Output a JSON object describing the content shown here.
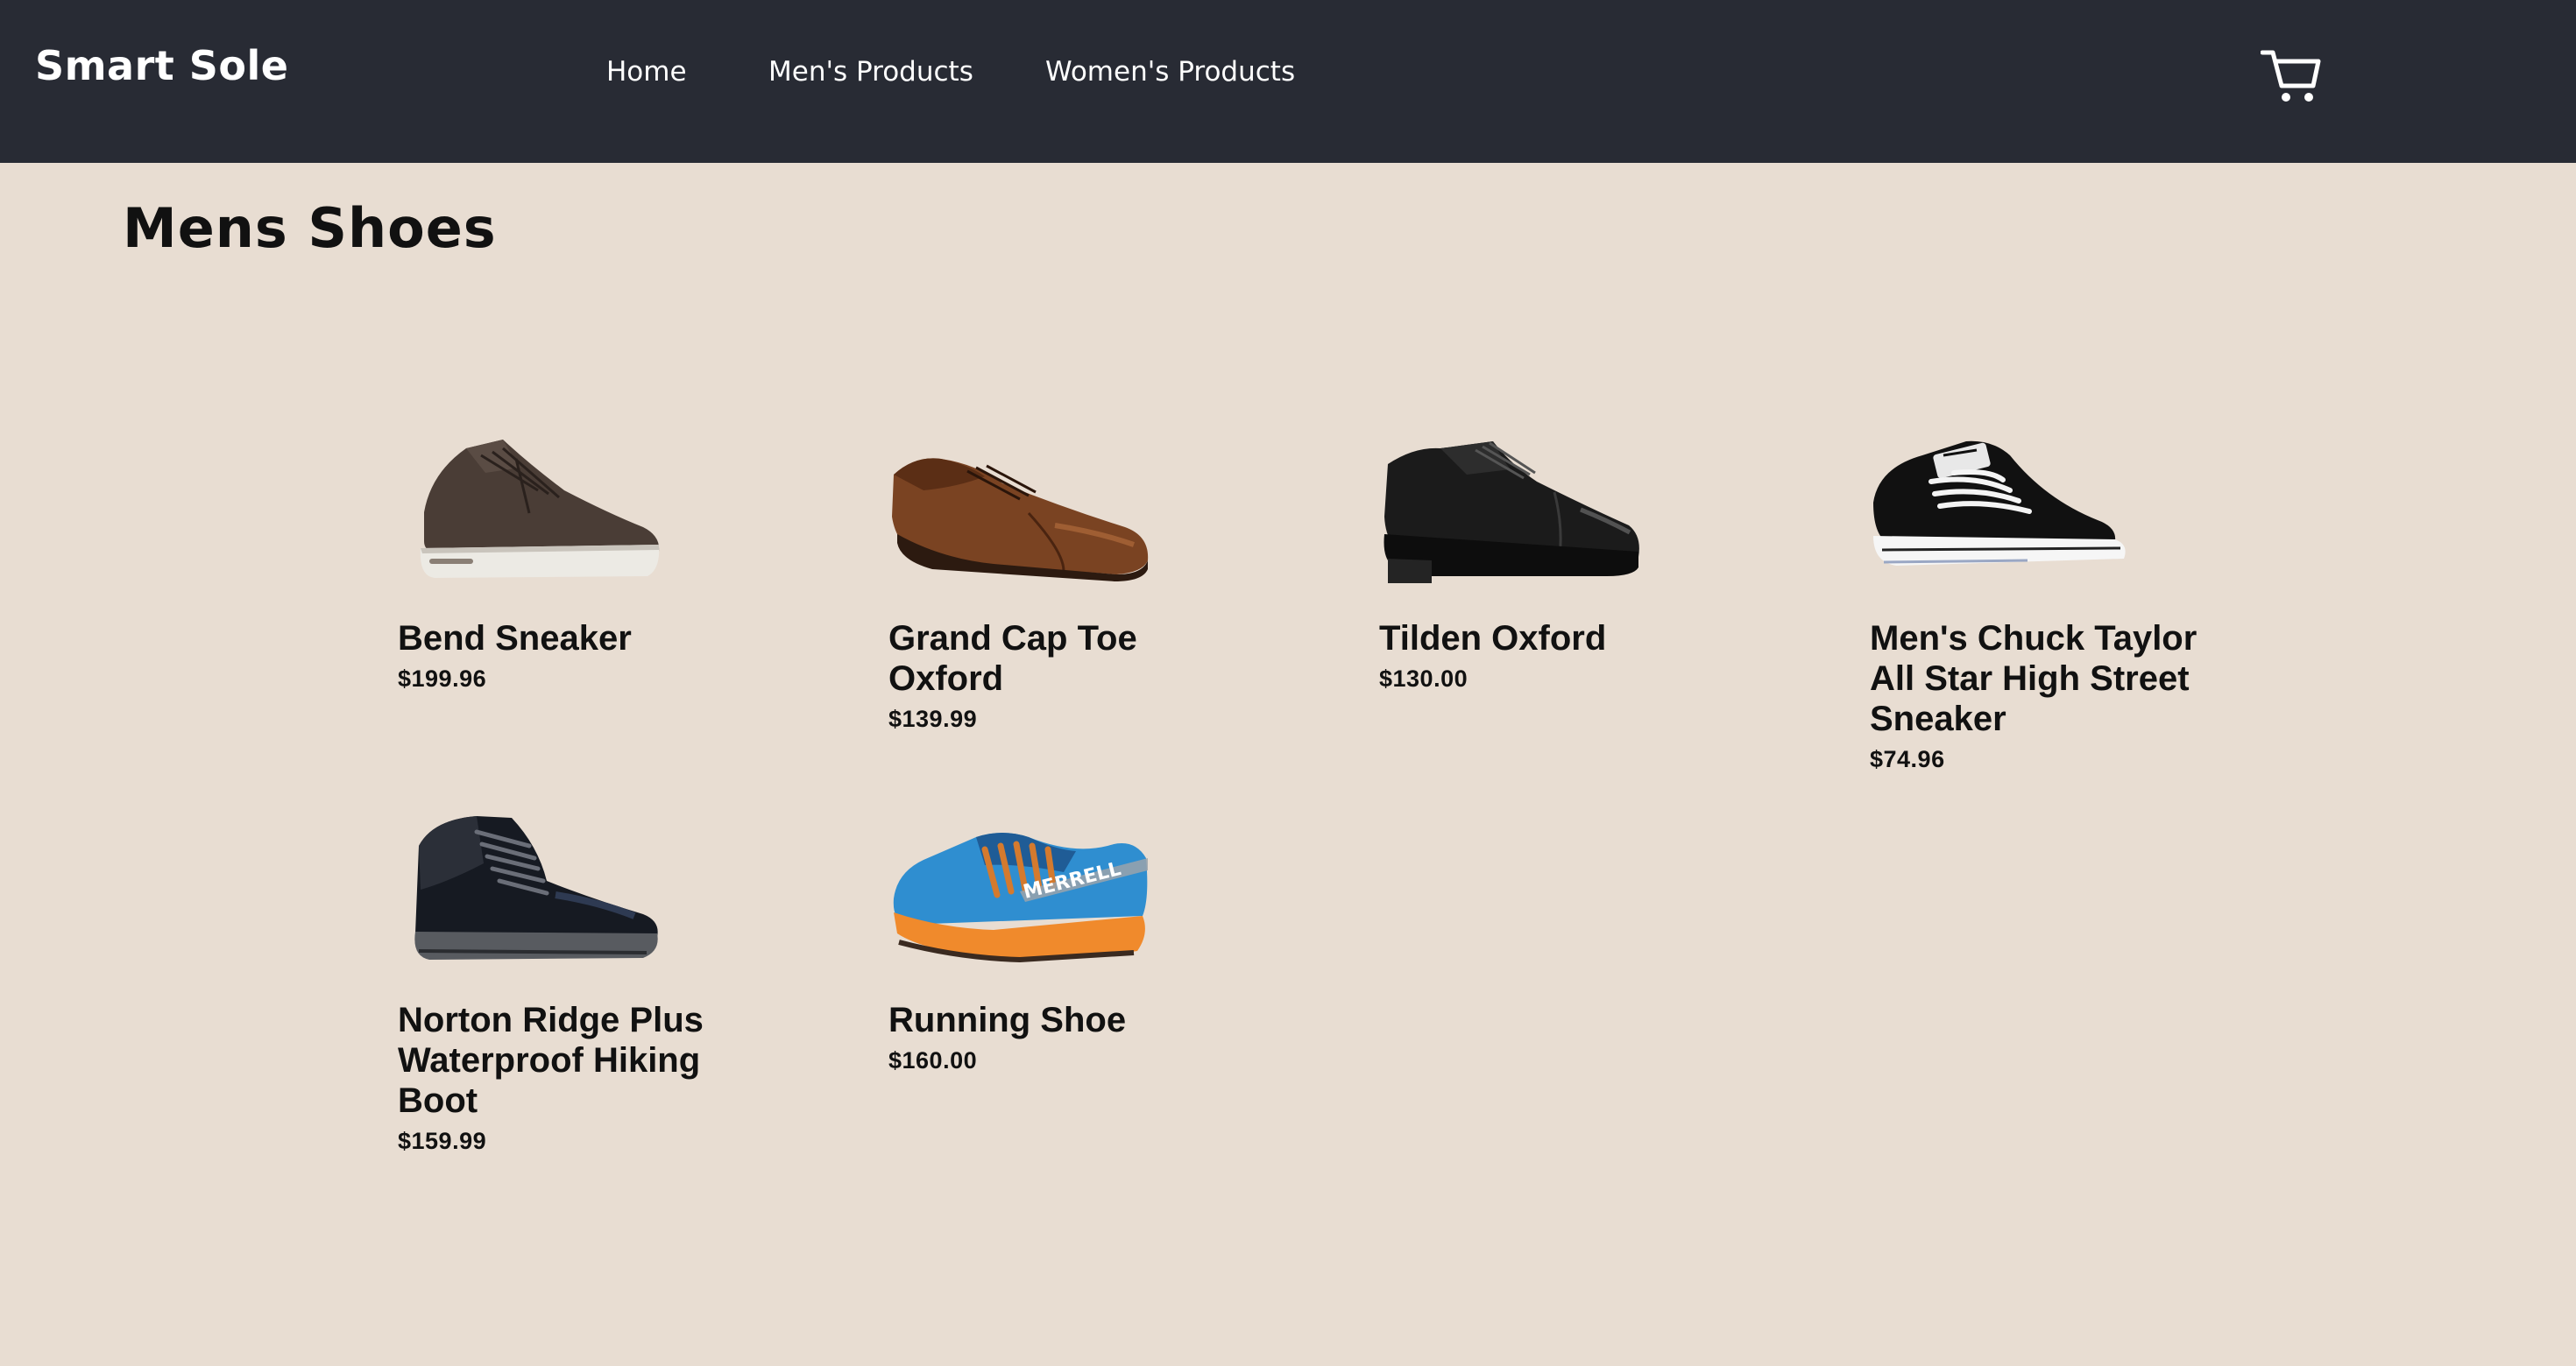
{
  "header": {
    "brand": "Smart Sole",
    "nav": [
      {
        "label": "Home"
      },
      {
        "label": "Men's Products"
      },
      {
        "label": "Women's Products"
      }
    ],
    "cart_icon": "shopping-cart-icon"
  },
  "main": {
    "title": "Mens Shoes",
    "products": [
      {
        "name": "Bend Sneaker",
        "price": "$199.96",
        "image_icon": "sneaker-image"
      },
      {
        "name": "Grand Cap Toe Oxford",
        "price": "$139.99",
        "image_icon": "brown-oxford-image"
      },
      {
        "name": "Tilden Oxford",
        "price": "$130.00",
        "image_icon": "black-oxford-image"
      },
      {
        "name": "Men's Chuck Taylor All Star High Street Sneaker",
        "price": "$74.96",
        "image_icon": "canvas-sneaker-image"
      },
      {
        "name": "Norton Ridge Plus Waterproof Hiking Boot",
        "price": "$159.99",
        "image_icon": "hiking-boot-image"
      },
      {
        "name": "Running Shoe",
        "price": "$160.00",
        "image_icon": "running-shoe-image",
        "image_text": "MERRELL"
      }
    ]
  },
  "colors": {
    "navbar": "#282b34",
    "background": "#e8ddd2",
    "text": "#111111",
    "nav_text": "#ffffff"
  }
}
